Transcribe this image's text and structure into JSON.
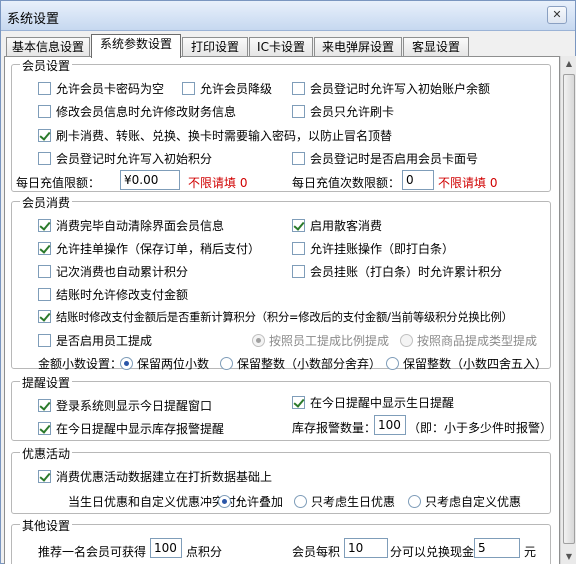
{
  "window": {
    "title": "系统设置",
    "close_label": "✕"
  },
  "tabs": [
    {
      "label": "基本信息设置"
    },
    {
      "label": "系统参数设置"
    },
    {
      "label": "打印设置"
    },
    {
      "label": "IC卡设置"
    },
    {
      "label": "来电弹屏设置"
    },
    {
      "label": "客显设置"
    }
  ],
  "member_settings": {
    "title": "会员设置",
    "allow_empty_card_pwd": {
      "label": "允许会员卡密码为空",
      "checked": false
    },
    "allow_member_downgrade": {
      "label": "允许会员降级",
      "checked": false
    },
    "allow_initial_balance": {
      "label": "会员登记时允许写入初始账户余额",
      "checked": false
    },
    "allow_edit_finance": {
      "label": "修改会员信息时允许修改财务信息",
      "checked": false
    },
    "swipe_only": {
      "label": "会员只允许刷卡",
      "checked": false
    },
    "require_password": {
      "label": "刷卡消费、转账、兑换、换卡时需要输入密码，以防止冒名顶替",
      "checked": true
    },
    "allow_initial_points": {
      "label": "会员登记时允许写入初始积分",
      "checked": false
    },
    "enable_card_face_no": {
      "label": "会员登记时是否启用会员卡面号",
      "checked": false
    },
    "daily_recharge_limit": {
      "label": "每日充值限额：",
      "value": "¥0.00",
      "hint": "不限请填 0"
    },
    "daily_recharge_times": {
      "label": "每日充值次数限额：",
      "value": "0",
      "hint": "不限请填 0"
    }
  },
  "member_consumption": {
    "title": "会员消费",
    "auto_clear": {
      "label": "消费完毕自动清除界面会员信息",
      "checked": true
    },
    "enable_walkin": {
      "label": "启用散客消费",
      "checked": true
    },
    "allow_hang_order": {
      "label": "允许挂单操作（保存订单，稍后支付）",
      "checked": true
    },
    "allow_credit": {
      "label": "允许挂账操作（即打白条）",
      "checked": false
    },
    "count_points_record": {
      "label": "记次消费也自动累计积分",
      "checked": false
    },
    "credit_points": {
      "label": "会员挂账（打白条）时允许累计积分",
      "checked": false
    },
    "allow_edit_pay_amount": {
      "label": "结账时允许修改支付金额",
      "checked": false
    },
    "recalc_points": {
      "label": "结账时修改支付金额后是否重新计算积分（积分=修改后的支付金额/当前等级积分兑换比例）",
      "checked": true
    },
    "enable_staff_commission": {
      "label": "是否启用员工提成",
      "checked": false
    },
    "commission_by_staff": {
      "label": "按照员工提成比例提成",
      "checked": true
    },
    "commission_by_product": {
      "label": "按照商品提成类型提成",
      "checked": false
    },
    "decimal_label": "金额小数设置：",
    "decimal_two": {
      "label": "保留两位小数",
      "checked": true
    },
    "decimal_floor": {
      "label": "保留整数（小数部分舍弃）",
      "checked": false
    },
    "decimal_round": {
      "label": "保留整数（小数四舍五入）",
      "checked": false
    }
  },
  "reminder_settings": {
    "title": "提醒设置",
    "show_today_window": {
      "label": "登录系统则显示今日提醒窗口",
      "checked": true
    },
    "show_birthday": {
      "label": "在今日提醒中显示生日提醒",
      "checked": true
    },
    "show_stock_alarm": {
      "label": "在今日提醒中显示库存报警提醒",
      "checked": true
    },
    "stock_alarm_qty": {
      "label": "库存报警数量：",
      "value": "100",
      "hint": "（即：小于多少件时报警）"
    }
  },
  "promotion": {
    "title": "优惠活动",
    "based_on_discount": {
      "label": "消费优惠活动数据建立在打折数据基础上",
      "checked": true
    },
    "conflict_label": "当生日优惠和自定义优惠冲突时：",
    "allow_stack": {
      "label": "允许叠加",
      "checked": true
    },
    "birthday_only": {
      "label": "只考虑生日优惠",
      "checked": false
    },
    "custom_only": {
      "label": "只考虑自定义优惠",
      "checked": false
    }
  },
  "other_settings": {
    "title": "其他设置",
    "referral_prefix": "推荐一名会员可获得",
    "referral_points": "100",
    "referral_suffix": "点积分",
    "redeem_prefix": "会员每积",
    "redeem_points": "10",
    "redeem_middle": "分可以兑换现金",
    "redeem_cash": "5",
    "redeem_suffix": "元"
  }
}
